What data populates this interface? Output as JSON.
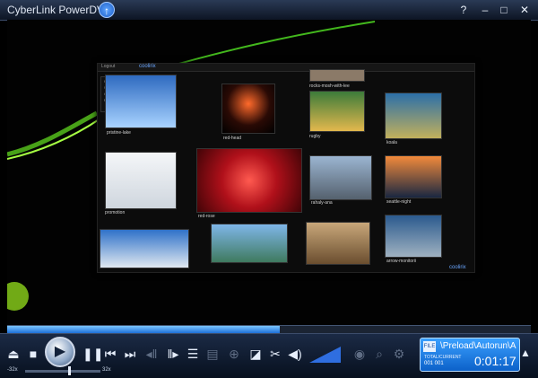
{
  "window": {
    "title": "CyberLink PowerDVD",
    "help": "?",
    "minimize": "–",
    "maximize": "□",
    "close": "✕",
    "upgrade_icon": "↑"
  },
  "gallery": {
    "header_text": "Logout",
    "logo_top": "coolirix",
    "logo_bottom": "coolirix",
    "sidebar": [
      "Welcome",
      "Shopping",
      "Galleries",
      "My Computer"
    ],
    "thumbs": [
      {
        "label": "pristine-lake"
      },
      {
        "label": "red-head"
      },
      {
        "label": "rocks-mosh-with-lee"
      },
      {
        "label": "rugby"
      },
      {
        "label": "koala"
      },
      {
        "label": "promotion"
      },
      {
        "label": "red-rose"
      },
      {
        "label": "rahaly-ana"
      },
      {
        "label": "seattle-night"
      },
      {
        "label": "arrow-monitorii"
      }
    ]
  },
  "controls": {
    "speed_min": "-32x",
    "speed_max": "32x",
    "progress": 0.52
  },
  "status": {
    "path": "\\Preload\\Autorun\\A",
    "label": "TOTAL/CURRENT",
    "count": "001  001",
    "time": "0:01:17"
  }
}
